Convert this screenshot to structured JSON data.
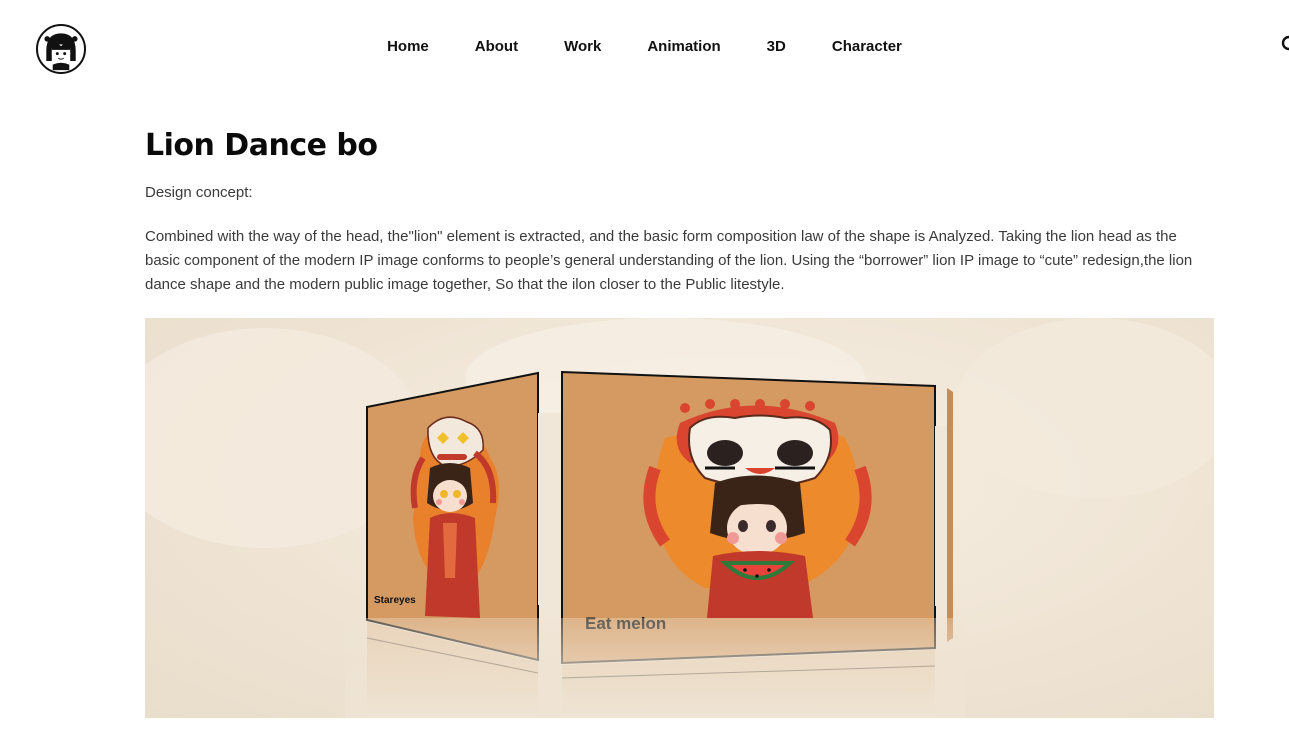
{
  "header": {
    "logo_icon": "avatar-girl-icon",
    "nav": [
      {
        "label": "Home"
      },
      {
        "label": "About"
      },
      {
        "label": "Work"
      },
      {
        "label": "Animation"
      },
      {
        "label": "3D"
      },
      {
        "label": "Character"
      }
    ],
    "search_icon": "search-icon"
  },
  "main": {
    "title": "Lion Dance bo",
    "concept_label": "Design concept:",
    "description": "Combined with the way of the head, the\"lion\" element is extracted, and the basic form composition law of the shape is Analyzed. Taking the lion head as the basic component of the modern IP image conforms to people’s general understanding of the lion. Using the “borrower” lion IP image to “cute” redesign,the lion dance shape and the modern public image together, So that the ilon closer to the Public litestyle."
  },
  "hero": {
    "left_panel_caption": "Stareyes",
    "right_panel_caption": "Eat melon",
    "colors": {
      "panel": "#d49a62",
      "lion_red": "#d9452e",
      "lion_orange": "#ec8a2c",
      "background": "#efe4d4"
    }
  }
}
